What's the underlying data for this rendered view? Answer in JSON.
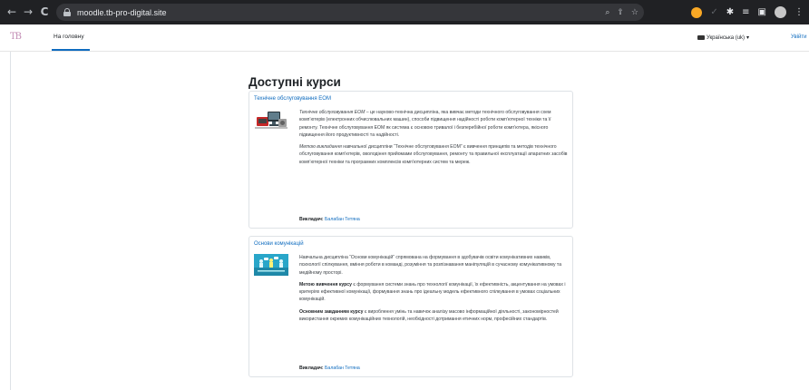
{
  "browser": {
    "url": "moodle.tb-pro-digital.site",
    "back_icon": "←",
    "forward_icon": "→",
    "reload_icon": "C"
  },
  "navbar": {
    "logo_text": "TB",
    "home_label": "На головну",
    "language_label": "Українська (uk)",
    "language_caret": "▾",
    "login_label": "Увійти"
  },
  "page": {
    "title": "Доступні курси"
  },
  "courses": [
    {
      "title": "Технічне обслуговування ЕОМ",
      "paragraphs": [
        {
          "em_lead": "Технічне обслуговування ЕОМ",
          "text": " – це науково-технічна дисципліна, яка вивчає методи технічного обслуговування схем комп’ютерів (електронних обчислювальних машин), способи підвищення надійності роботи комп’ютерної техніки та її ремонту. Технічне обслуговування ЕОМ як система є основою тривалої і безперебійної роботи комп’ютера, якісного підвищення його продуктивності та надійності."
        },
        {
          "em_lead": "Метою викладання",
          "text": " навчальної дисципліни “Технічне обслуговування ЕОМ” є вивчення принципів та методів технічного обслуговування комп’ютерів, оволодіння прийомами обслуговування, ремонту та правильної експлуатації апаратних засобів комп’ютерної техніки та програмних комплексів комп’ютерних систем та мереж."
        }
      ],
      "teacher_label": "Викладач:",
      "teacher_name": "Балабан Тетяна"
    },
    {
      "title": "Основи комунікацій",
      "paragraphs": [
        {
          "lead": "",
          "text": "Навчальна дисципліна “Основи комунікацій” спрямована на формування в здобувачів освіти комунікативних навиків, психології спілкування, вміння роботи в команді, розуміння та розпізнавання маніпуляцій в сучасному комунікативному та медійному просторі."
        },
        {
          "lead": "Метою вивчення курсу",
          "text": " є формування системи знань про технології комунікації, їх ефективність, акцентування на умовах і критеріях ефективної комунікації, формування знань про ідеальну модель ефективного спілкування в умовах соціальних комунікацій."
        },
        {
          "lead": "Основним завданням курсу",
          "text": " є вироблення умінь та навичок аналізу масово інформаційної діяльності, закономірностей використання окремих комунікаційних технологій, необхідності дотримання етичних норм, професійних стандартів."
        }
      ],
      "teacher_label": "Викладач:",
      "teacher_name": "Балабан Тетяна"
    }
  ],
  "colors": {
    "link": "#0f6cbf",
    "chrome_bg": "#202124",
    "omnibox_bg": "#35363a",
    "nav_underline": "#0f6cbf"
  },
  "icons": {
    "back": "arrow-left-icon",
    "forward": "arrow-right-icon",
    "reload": "reload-icon",
    "lock": "lock-icon",
    "zoom": "zoom-icon",
    "share": "share-icon",
    "bookmark": "star-icon",
    "extensions": "puzzle-icon",
    "profile": "avatar-icon",
    "menu": "kebab-menu-icon",
    "keyboard": "keyboard-icon"
  }
}
